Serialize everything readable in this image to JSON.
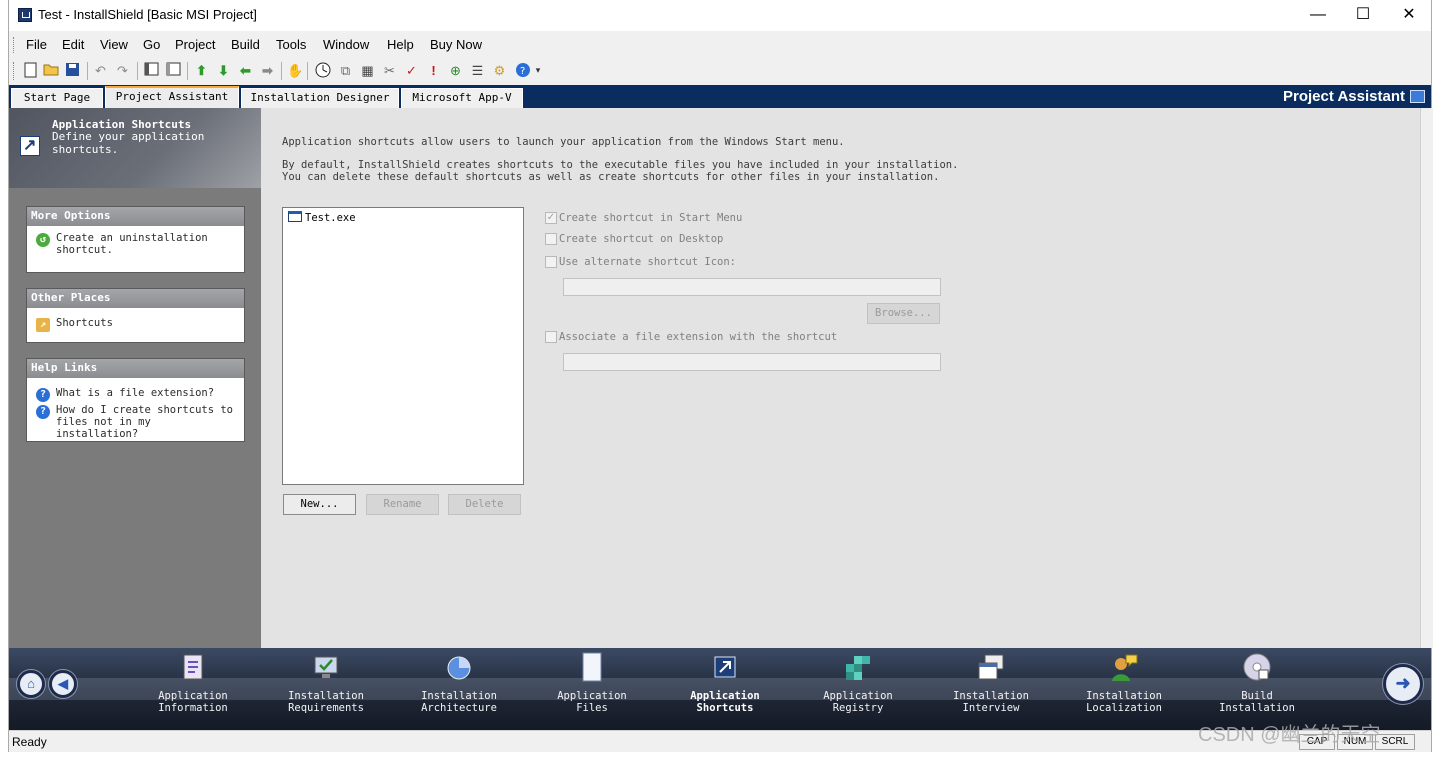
{
  "window": {
    "title": "Test - InstallShield [Basic MSI Project]",
    "minimize": "—",
    "maximize": "☐",
    "close": "✕"
  },
  "menu": [
    "File",
    "Edit",
    "View",
    "Go",
    "Project",
    "Build",
    "Tools",
    "Window",
    "Help",
    "Buy Now"
  ],
  "toolbar_icons": [
    "new-file-icon",
    "open-folder-icon",
    "save-icon",
    "undo-icon",
    "redo-icon",
    "panel-left-icon",
    "panel-right-icon",
    "arrow-up-icon",
    "arrow-down-icon",
    "arrow-left-icon",
    "arrow-right-icon",
    "hand-icon",
    "compile-icon",
    "build-icon",
    "release-icon",
    "cancel-build-icon",
    "validate-icon",
    "error-icon",
    "run-icon",
    "debug-icon",
    "settings-icon",
    "help-icon"
  ],
  "tabs": [
    "Start Page",
    "Project Assistant",
    "Installation Designer",
    "Microsoft App-V"
  ],
  "active_tab": "Project Assistant",
  "panel_title": "Project Assistant",
  "left": {
    "header_title": "Application Shortcuts",
    "header_subtitle": "Define your application shortcuts.",
    "more_options": {
      "title": "More Options",
      "items": [
        "Create an uninstallation shortcut."
      ]
    },
    "other_places": {
      "title": "Other Places",
      "items": [
        "Shortcuts"
      ]
    },
    "help_links": {
      "title": "Help Links",
      "items": [
        "What is a file extension?",
        "How do I create shortcuts to files not in my installation?"
      ]
    }
  },
  "main": {
    "intro": "Application shortcuts allow users to launch your application from the Windows Start menu.",
    "desc_line1": "By default, InstallShield creates shortcuts to the executable files you have included in your installation.",
    "desc_line2": "You can delete these default shortcuts as well as create shortcuts for other files in your installation.",
    "list_items": [
      "Test.exe"
    ],
    "buttons": {
      "new": "New...",
      "rename": "Rename",
      "delete": "Delete",
      "browse": "Browse..."
    },
    "options": {
      "start_menu": "Create shortcut in Start Menu",
      "desktop": "Create shortcut on Desktop",
      "alt_icon": "Use alternate shortcut Icon:",
      "file_ext": "Associate a file extension with the shortcut"
    },
    "option_states": {
      "start_menu": true,
      "desktop": false,
      "alt_icon": false,
      "file_ext": false
    },
    "alt_icon_value": "",
    "file_ext_value": ""
  },
  "nav": [
    {
      "line1": "Application",
      "line2": "Information",
      "icon": "application-information-icon"
    },
    {
      "line1": "Installation",
      "line2": "Requirements",
      "icon": "installation-requirements-icon"
    },
    {
      "line1": "Installation",
      "line2": "Architecture",
      "icon": "installation-architecture-icon"
    },
    {
      "line1": "Application",
      "line2": "Files",
      "icon": "application-files-icon"
    },
    {
      "line1": "Application",
      "line2": "Shortcuts",
      "icon": "application-shortcuts-icon"
    },
    {
      "line1": "Application",
      "line2": "Registry",
      "icon": "application-registry-icon"
    },
    {
      "line1": "Installation",
      "line2": "Interview",
      "icon": "installation-interview-icon"
    },
    {
      "line1": "Installation",
      "line2": "Localization",
      "icon": "installation-localization-icon"
    },
    {
      "line1": "Build",
      "line2": "Installation",
      "icon": "build-installation-icon"
    }
  ],
  "nav_active": "Application Shortcuts",
  "status": {
    "text": "Ready",
    "cap": "CAP",
    "num": "NUM",
    "scrl": "SCRL"
  },
  "watermark": "CSDN @幽兰的天空",
  "colors": {
    "tab_bar": "#0a2c5f",
    "active_tab_accent": "#f4a93a",
    "nav_bar": "#202838",
    "content_bg": "#e3e3e3"
  }
}
